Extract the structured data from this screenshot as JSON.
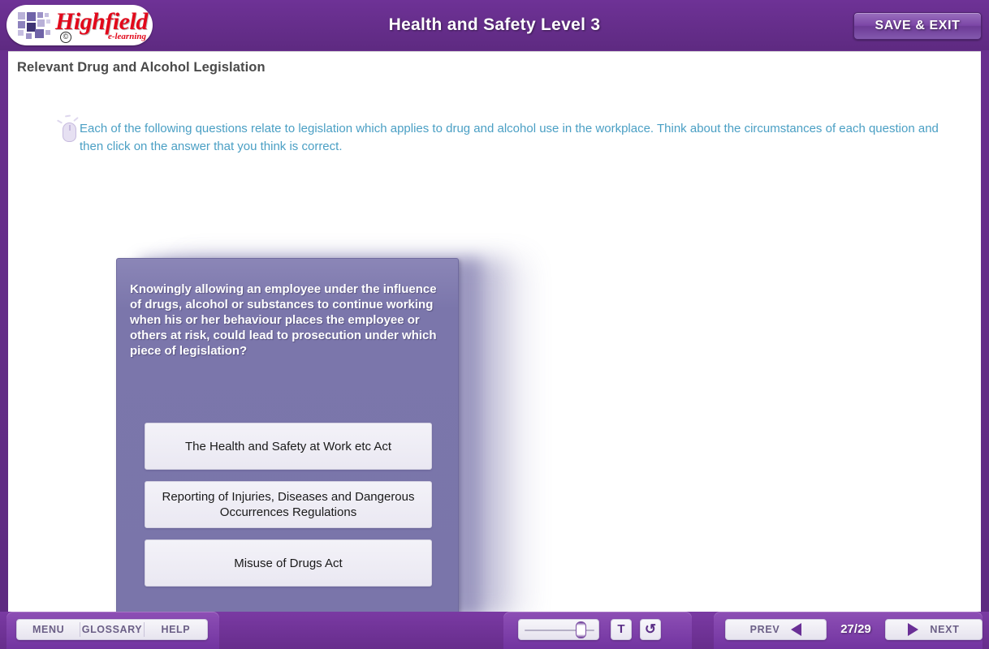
{
  "header": {
    "course_title": "Health and Safety Level 3",
    "save_exit_label": "SAVE & EXIT",
    "logo": {
      "wordmark": "Highfield",
      "tagline": "e-learning",
      "copyright": "©"
    }
  },
  "page": {
    "title": "Relevant Drug and Alcohol Legislation",
    "instruction": "Each of the following questions relate to legislation which applies to drug and alcohol use in the workplace. Think about the circumstances of each question and then click on the answer that you think is correct."
  },
  "question": {
    "prompt": "Knowingly allowing an employee under the influence of drugs, alcohol or substances to continue working when his or her behaviour places the employee or others at risk, could lead to prosecution under which piece of legislation?",
    "answers": [
      {
        "label": "The Health and Safety at Work etc Act"
      },
      {
        "label": "Reporting of Injuries, Diseases and Dangerous Occurrences Regulations"
      },
      {
        "label": "Misuse of Drugs Act"
      }
    ]
  },
  "footer": {
    "menu_label": "MENU",
    "glossary_label": "GLOSSARY",
    "help_label": "HELP",
    "text_button_label": "T",
    "replay_button_label": "↺",
    "prev_label": "PREV",
    "next_label": "NEXT",
    "page_counter": "27/29",
    "slider_value_percent": 88
  },
  "colors": {
    "brand_purple": "#6b2f91",
    "panel_purple": "#7b76ab",
    "instruction_blue": "#4a9fc4",
    "logo_red": "#e2091b",
    "answer_bg": "#eae8f2"
  }
}
